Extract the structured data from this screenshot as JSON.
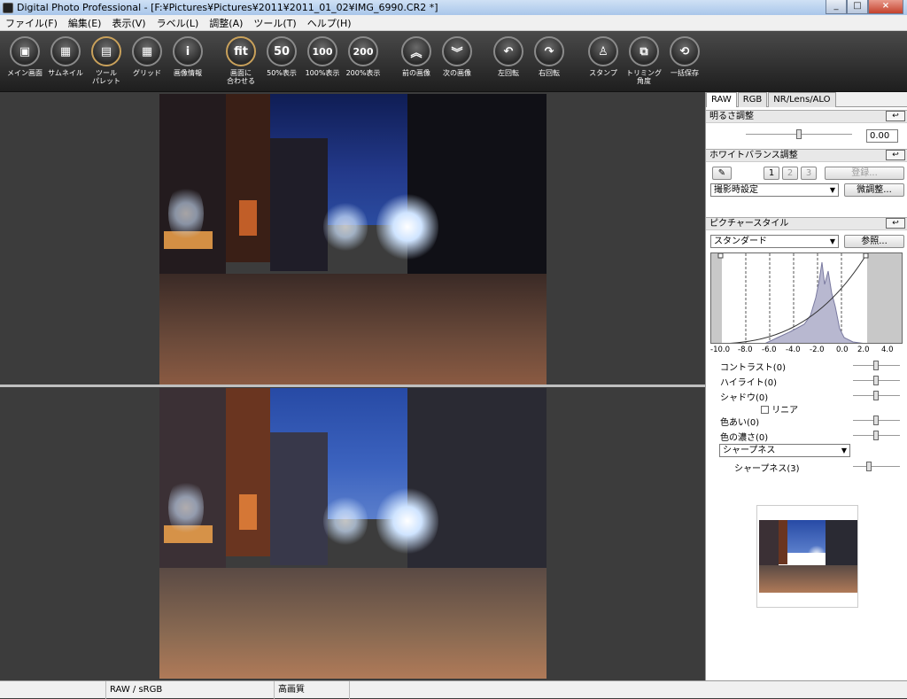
{
  "window": {
    "title": "Digital Photo Professional - [F:¥Pictures¥Pictures¥2011¥2011_01_02¥IMG_6990.CR2 *]",
    "controls": [
      "_",
      "□",
      "×"
    ]
  },
  "menu": [
    "ファイル(F)",
    "編集(E)",
    "表示(V)",
    "ラベル(L)",
    "調整(A)",
    "ツール(T)",
    "ヘルプ(H)"
  ],
  "toolbar": [
    {
      "label": "メイン画面",
      "glyph": "▣"
    },
    {
      "label": "サムネイル",
      "glyph": "▦"
    },
    {
      "label": "ツール\nパレット",
      "glyph": "▤"
    },
    {
      "label": "グリッド",
      "glyph": "▦"
    },
    {
      "label": "画像情報",
      "glyph": "i"
    },
    {
      "label": "画面に\n合わせる",
      "glyph": "fit"
    },
    {
      "label": "50%表示",
      "glyph": "50"
    },
    {
      "label": "100%表示",
      "glyph": "100"
    },
    {
      "label": "200%表示",
      "glyph": "200"
    },
    {
      "label": "前の画像",
      "glyph": "︽"
    },
    {
      "label": "次の画像",
      "glyph": "︾"
    },
    {
      "label": "左回転",
      "glyph": "↶"
    },
    {
      "label": "右回転",
      "glyph": "↷"
    },
    {
      "label": "スタンプ",
      "glyph": "♙"
    },
    {
      "label": "トリミング\n角度",
      "glyph": "⧉"
    },
    {
      "label": "一括保存",
      "glyph": "⟲"
    }
  ],
  "panel": {
    "tabs": [
      "RAW",
      "RGB",
      "NR/Lens/ALO"
    ],
    "brightness": {
      "title": "明るさ調整",
      "value": "0.00",
      "reset": "↩"
    },
    "white_balance": {
      "title": "ホワイトバランス調整",
      "slots": [
        "1",
        "2",
        "3"
      ],
      "register": "登録...",
      "mode": "撮影時設定",
      "fine": "微調整..."
    },
    "picture_style": {
      "title": "ピクチャースタイル",
      "style": "スタンダード",
      "browse": "参照...",
      "ticks": [
        "-10.0",
        "-8.0",
        "-6.0",
        "-4.0",
        "-2.0",
        "0.0",
        "2.0",
        "4.0"
      ],
      "params": [
        "コントラスト(0)",
        "ハイライト(0)",
        "シャドウ(0)"
      ],
      "linear": "リニア",
      "color_params": [
        "色あい(0)",
        "色の濃さ(0)"
      ],
      "sharp_mode": "シャープネス",
      "sharpness": "シャープネス(3)"
    }
  },
  "status": {
    "cells": [
      "",
      "RAW / sRGB",
      "高画質"
    ]
  }
}
